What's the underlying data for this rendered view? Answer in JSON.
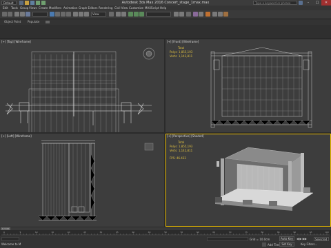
{
  "title_bar": {
    "workspace": "Default",
    "title": "Autodesk 3ds Max 2016    Concert_stage_1max.max",
    "search_placeholder": "Type a keyword or phrase"
  },
  "menu": [
    "Edit",
    "Tools",
    "Group",
    "Views",
    "Create",
    "Modifiers",
    "Animation",
    "Graph Editors",
    "Rendering",
    "Civil View",
    "Customize",
    "MAXScript",
    "Help"
  ],
  "toolbar": {
    "view_select": "View"
  },
  "ribbon": {
    "tabs": [
      "Object Paint",
      "Populate"
    ]
  },
  "viewports": {
    "top": {
      "label": "[+] [Top] [Wireframe]"
    },
    "front": {
      "label": "[+] [Front] [Wireframe]",
      "total_label": "Total",
      "polys_label": "Polys:",
      "polys": "1,855,193",
      "verts_label": "Verts:",
      "verts": "1,142,811"
    },
    "left": {
      "label": "[+] [Left] [Wireframe]"
    },
    "perspective": {
      "label": "[+] [Perspective] [Shaded]",
      "total_label": "Total",
      "polys_label": "Polys:",
      "polys": "1,855,193",
      "verts_label": "Verts:",
      "verts": "1,142,811",
      "fps_label": "FPS:",
      "fps": "46.432"
    }
  },
  "timeline": {
    "frame": "0 / 100",
    "ticks": [
      "0",
      "5",
      "10",
      "15",
      "20",
      "25",
      "30",
      "35",
      "40",
      "45",
      "50",
      "55",
      "60",
      "65",
      "70",
      "75",
      "80",
      "85",
      "90",
      "95",
      "100"
    ]
  },
  "status": {
    "welcome": "Welcome to M",
    "grid": "Grid = 10.0cm",
    "auto_key": "Auto Key",
    "selected": "Selected",
    "set_key": "Set Key",
    "key_filters": "Key Filters...",
    "add_time_tag": "Add Time Tag"
  },
  "colors": {
    "viewport_bg": "#3d3d3d",
    "stats_yellow": "#e0c040",
    "active_border": "#f0c000",
    "timeline_red": "#b02020"
  }
}
